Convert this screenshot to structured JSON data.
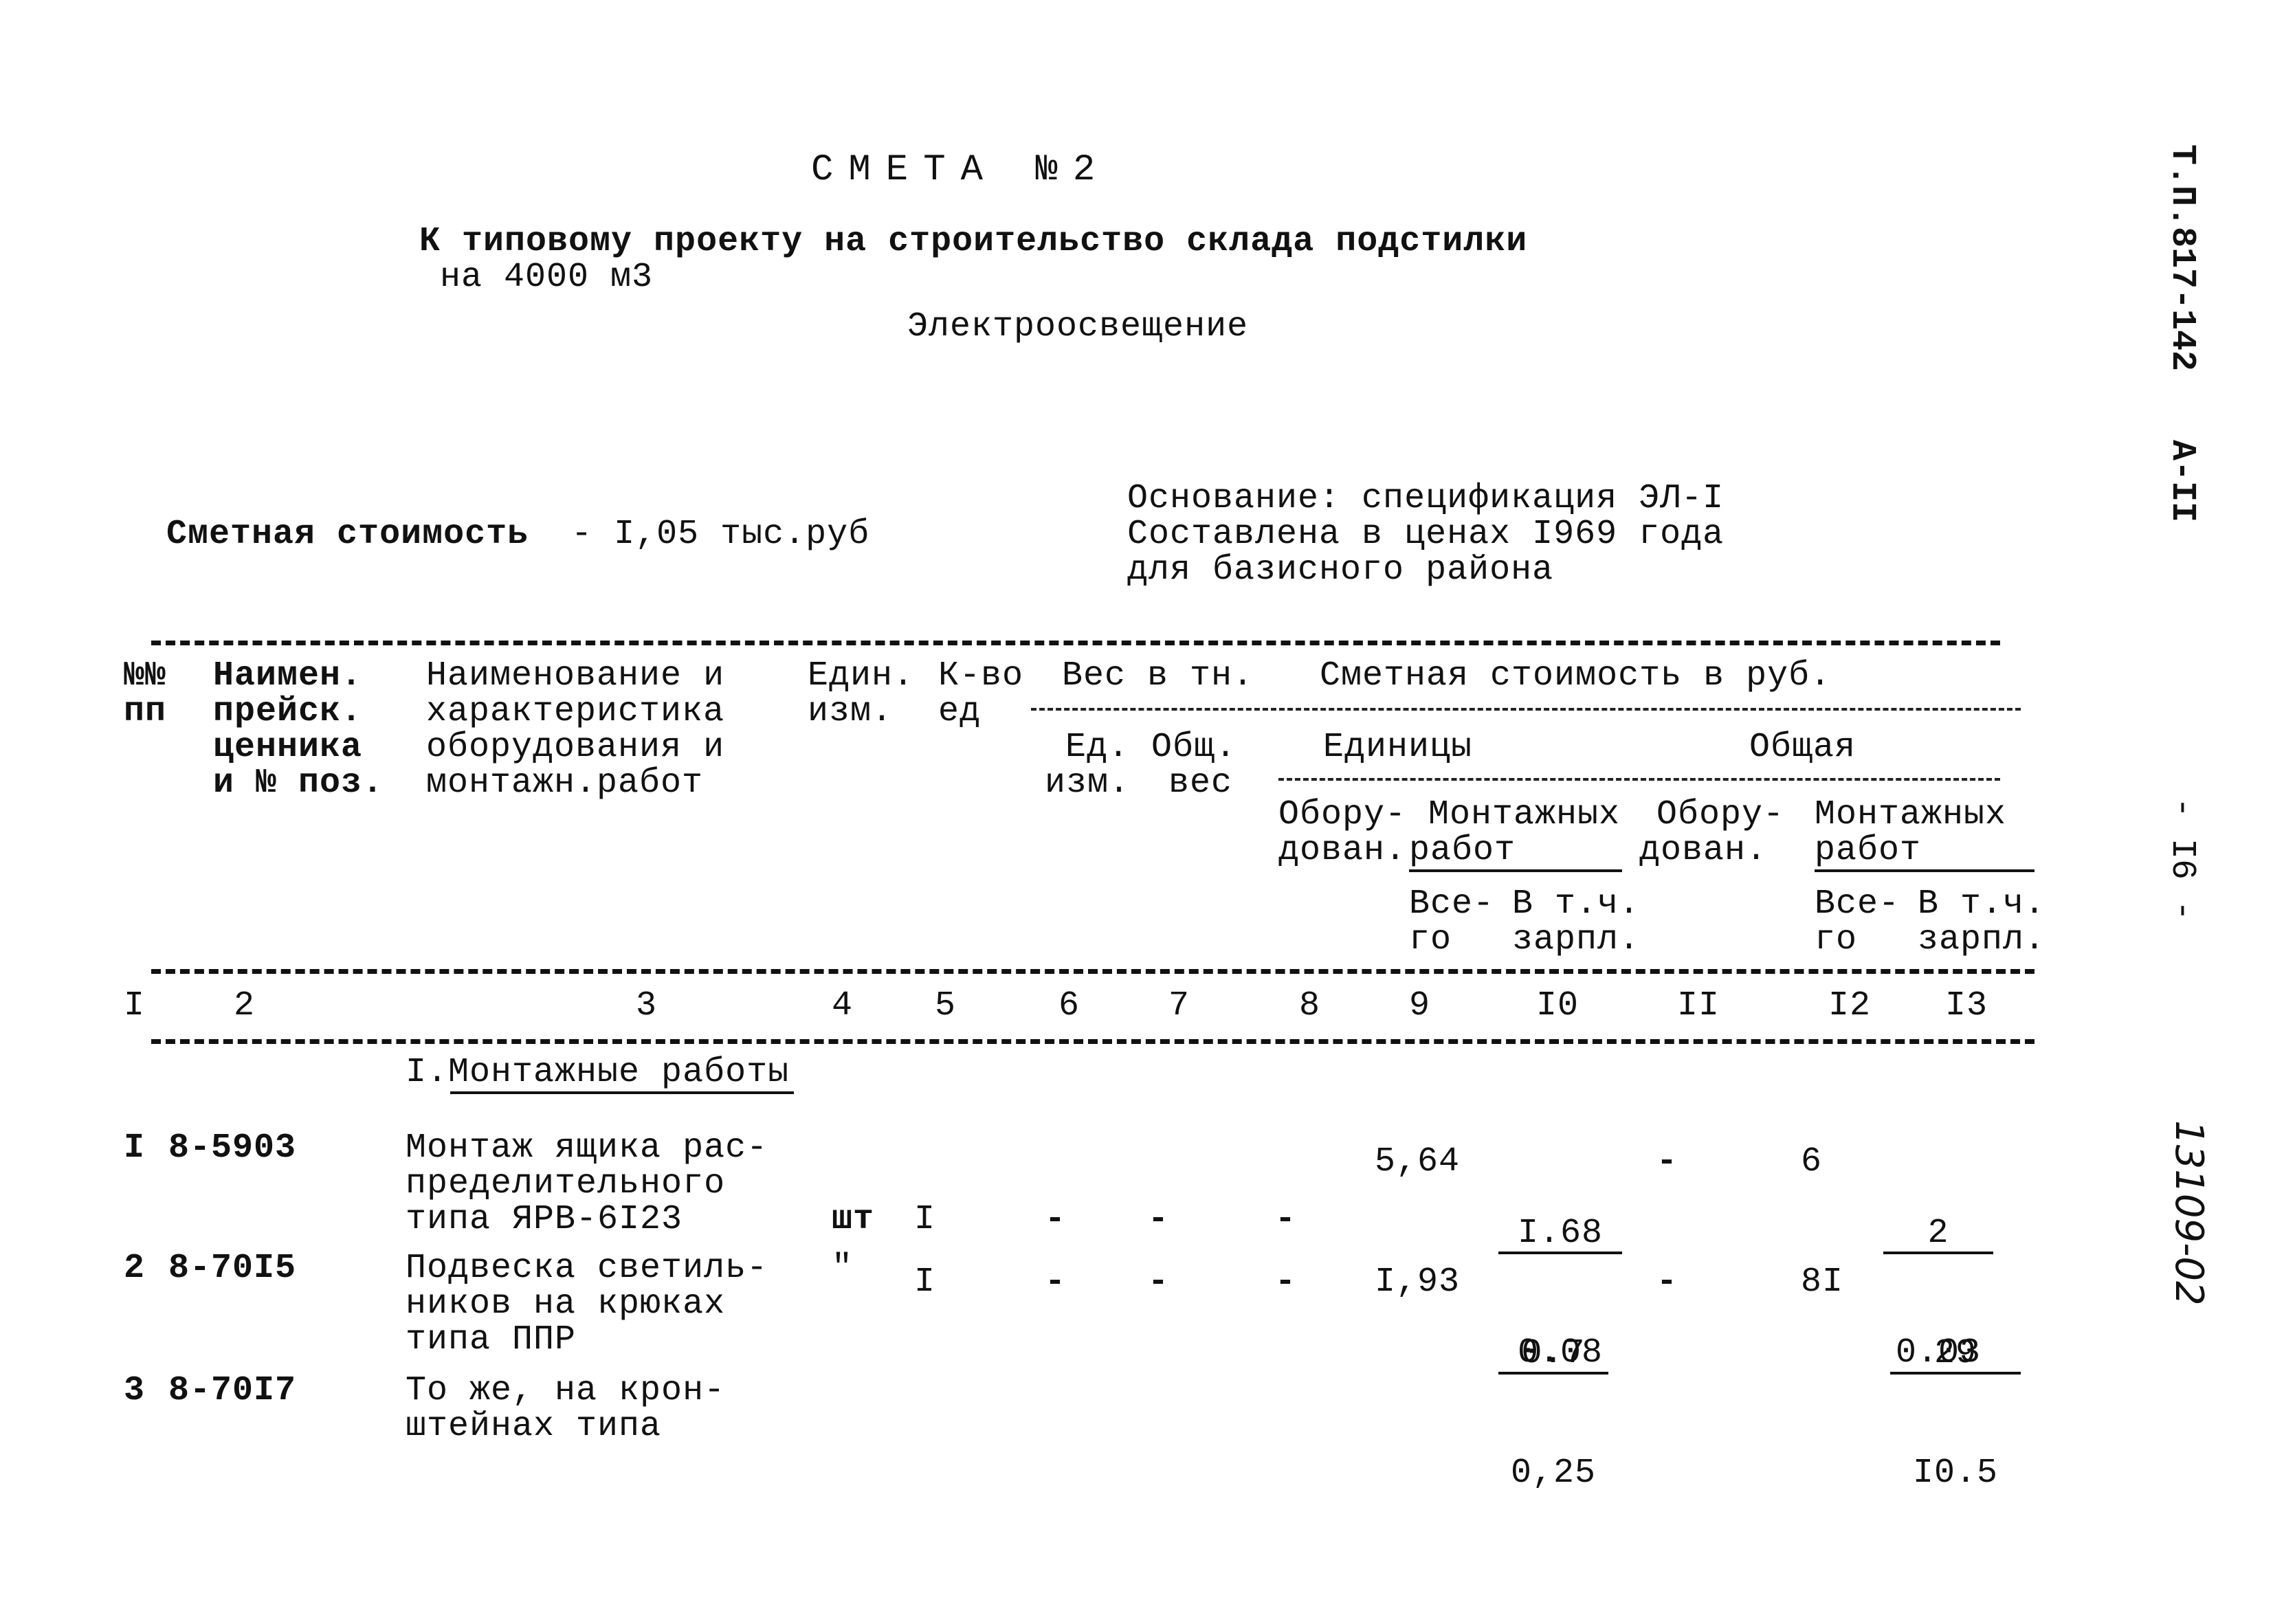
{
  "header": {
    "title": "СМЕТА №2",
    "subtitle_line1": "К типовому проекту на строительство склада подстилки",
    "subtitle_line2": "на 4000 м3",
    "section": "Электроосвещение"
  },
  "margin": {
    "project_code": "Т.П.817-142",
    "album": "А-II",
    "page": "- I6 -",
    "inventory_number": "13109-02"
  },
  "summary": {
    "cost_label": "Сметная стоимость",
    "cost_value": "- I,05 тыс.руб",
    "basis_line1": "Основание: спецификация ЭЛ-I",
    "basis_line2": "Составлена в ценах I969 года",
    "basis_line3": "для базисного района"
  },
  "table": {
    "headers": {
      "col1": [
        "№№",
        "пп"
      ],
      "col2": [
        "Наимен.",
        "прейск.",
        "ценника",
        "и № поз."
      ],
      "col3": [
        "Наименование и",
        "характеристика",
        "оборудования и",
        "монтажн.работ"
      ],
      "col4": [
        "Един.",
        "изм."
      ],
      "col5": [
        "К-во",
        "ед"
      ],
      "weight_group": "Вес в тн.",
      "col6": [
        "Ед.",
        "изм."
      ],
      "col7": [
        "Общ.",
        "вес"
      ],
      "cost_group": "Сметная стоимость в руб.",
      "unit_group": "Единицы",
      "total_group": "Общая",
      "equip": [
        "Обору-",
        "дован."
      ],
      "install": [
        "Монтажных",
        "работ"
      ],
      "all": [
        "Все-",
        "го"
      ],
      "wages": [
        "В т.ч.",
        "зарпл."
      ]
    },
    "column_numbers": [
      "I",
      "2",
      "3",
      "4",
      "5",
      "6",
      "7",
      "8",
      "9",
      "I0",
      "II",
      "I2",
      "I3"
    ],
    "section_title": "I.Монтажные работы",
    "rows": [
      {
        "num": "I",
        "code": "8-5903",
        "name": [
          "Монтаж ящика рас-",
          "пределительного",
          "типа ЯРВ-6I23"
        ],
        "unit": "шт",
        "qty": "I",
        "weight_unit": "-",
        "weight_total": "-",
        "unit_equip": "-",
        "unit_install_total": "5,64",
        "unit_install_wages_num": "I.68",
        "unit_install_wages_den": "0.08",
        "total_equip": "-",
        "total_install_total": "6",
        "total_install_wages_num": "2",
        "total_install_wages_den": "0.03"
      },
      {
        "num": "2",
        "code": "8-70I5",
        "name": [
          "Подвеска светиль-",
          "ников на крюках",
          "типа ППР"
        ],
        "unit": "\"",
        "qty": "I",
        "weight_unit": "-",
        "weight_total": "-",
        "unit_equip": "-",
        "unit_install_total": "I,93",
        "unit_install_wages_num": "0.7",
        "unit_install_wages_den": "0,25",
        "total_equip": "-",
        "total_install_total": "8I",
        "total_install_wages_num": "29",
        "total_install_wages_den": "I0.5"
      },
      {
        "num": "3",
        "code": "8-70I7",
        "name": [
          "То же, на крон-",
          "штейнах типа"
        ]
      }
    ]
  }
}
